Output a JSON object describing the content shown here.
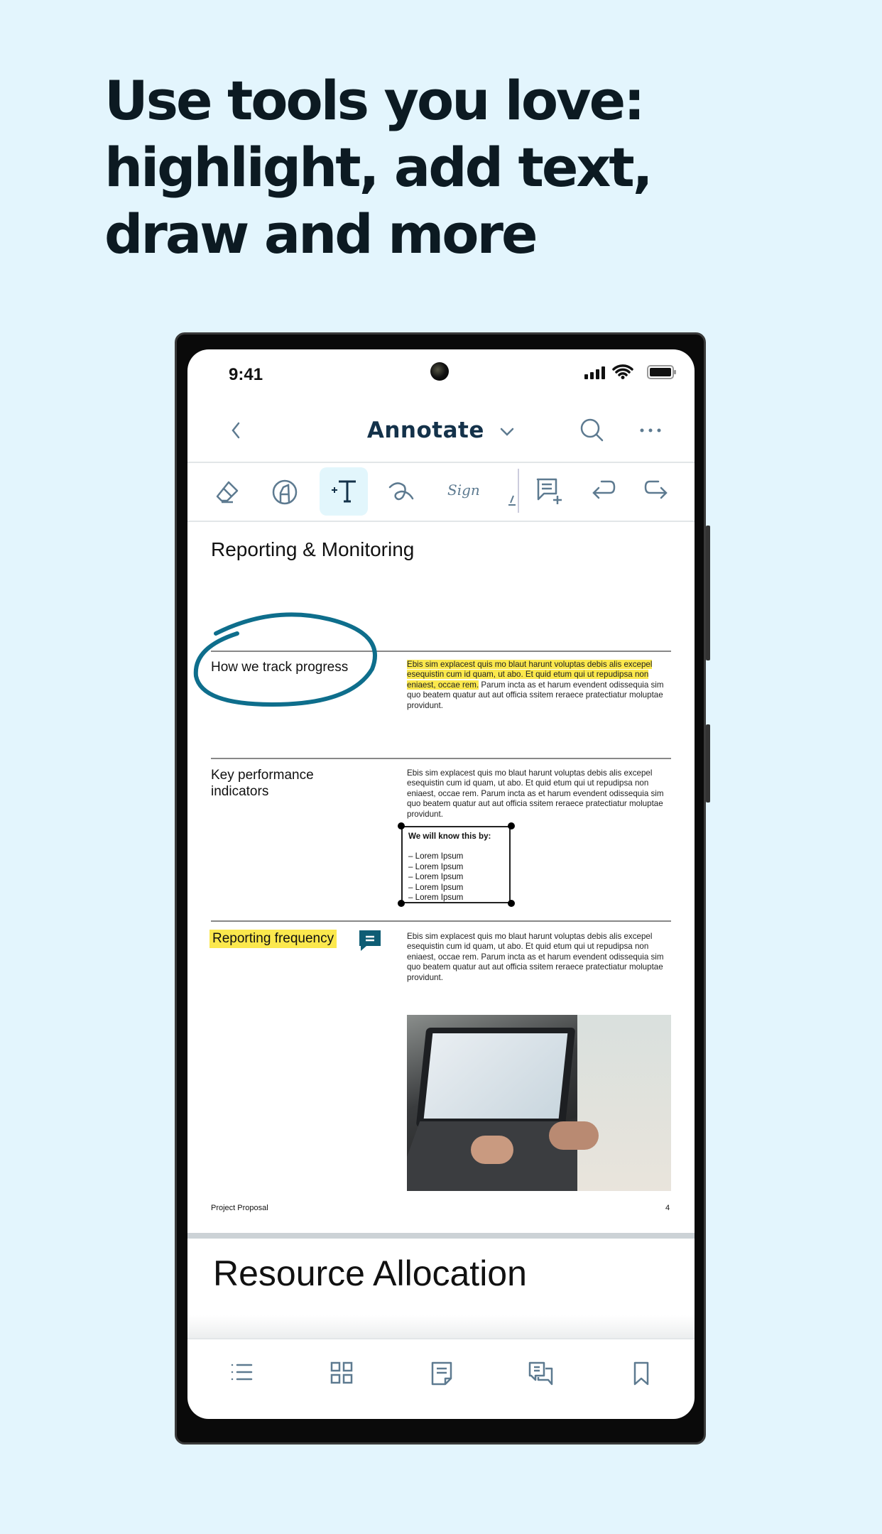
{
  "headline": [
    "Use tools you love:",
    "highlight, add text,",
    "draw and more"
  ],
  "status": {
    "time": "9:41"
  },
  "header": {
    "title": "Annotate"
  },
  "toolbar": {
    "tools": [
      "eraser-icon",
      "highlighter-icon",
      "add-text-icon",
      "freehand-draw-icon",
      "signature-icon",
      "shape-icon",
      "add-note-icon",
      "undo-icon",
      "redo-icon"
    ],
    "active": "add-text-icon",
    "signature_label": "Sign"
  },
  "document": {
    "page_title": "Reporting & Monitoring",
    "sections": [
      {
        "label": "How we track progress",
        "highlighted_text": "Ebis sim explacest quis mo blaut harunt voluptas debis alis excepel esequistin cum id quam, ut abo. Et quid etum qui ut repudipsa non eniaest, occae rem.",
        "text": " Parum incta as et harum evendent odissequia sim quo beatem quatur aut aut officia ssitem reraece pratectiatur moluptae providunt."
      },
      {
        "label": "Key performance indicators",
        "text": "Ebis sim explacest quis mo blaut harunt voluptas debis alis excepel esequistin cum id quam, ut abo. Et quid etum qui ut repudipsa non eniaest, occae rem. Parum incta as et harum evendent odissequia sim quo beatem quatur aut aut officia ssitem reraece pratectiatur moluptae providunt.",
        "box_title": "We will know this by:",
        "box_items": [
          "– Lorem Ipsum",
          "– Lorem Ipsum",
          "– Lorem Ipsum",
          "– Lorem Ipsum",
          "– Lorem Ipsum"
        ]
      },
      {
        "label": "Reporting frequency",
        "text": "Ebis sim explacest quis mo blaut harunt voluptas debis alis excepel esequistin cum id quam, ut abo. Et quid etum qui ut repudipsa non eniaest, occae rem. Parum incta as et harum evendent odissequia sim quo beatem quatur aut aut officia ssitem reraece pratectiatur moluptae providunt."
      }
    ],
    "footer_left": "Project Proposal",
    "footer_page": "4",
    "next_page_title": "Resource Allocation"
  },
  "bottom_nav": [
    "outline-icon",
    "thumbnails-icon",
    "page-icon",
    "comments-icon",
    "bookmark-icon"
  ],
  "colors": {
    "background": "#e3f5fd",
    "highlight": "#fbe84d",
    "annotation_ink": "#0e6e8c",
    "icon": "#5d7a90",
    "title": "#14324a"
  }
}
